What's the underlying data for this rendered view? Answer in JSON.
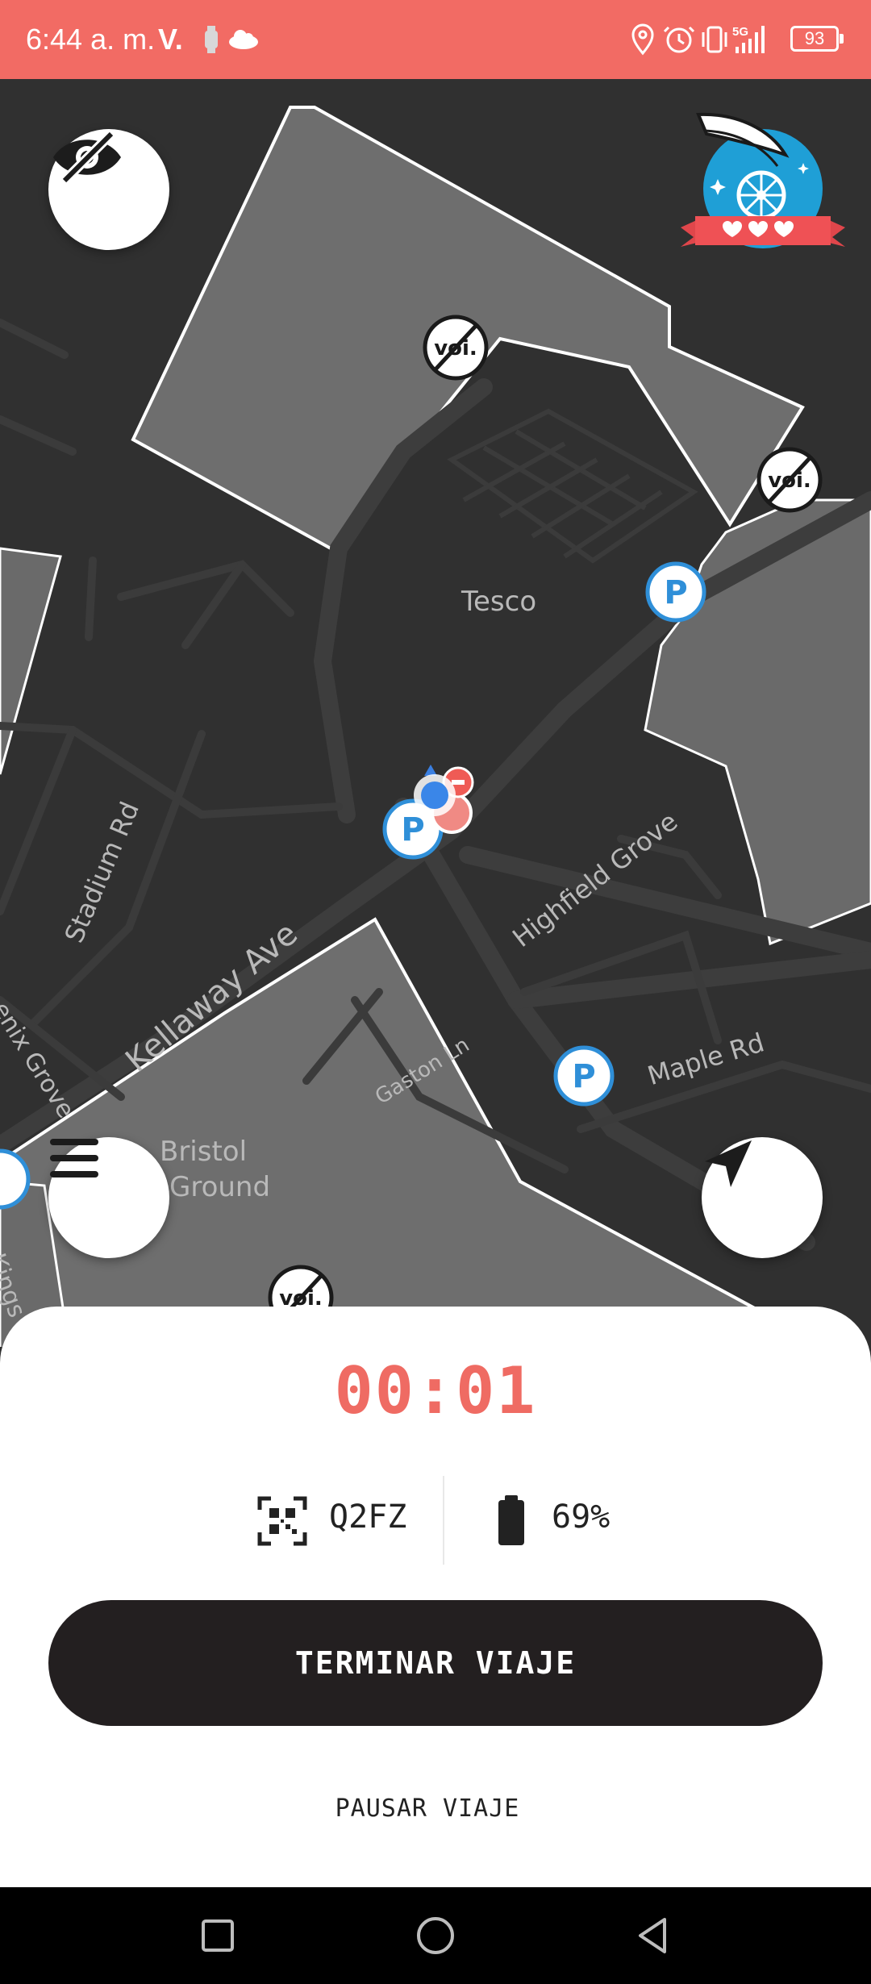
{
  "status_bar": {
    "time": "6:44 a. m.",
    "carrier": "V.",
    "network": "5G",
    "battery": "93",
    "background_color": "#f26b64"
  },
  "map": {
    "labels": {
      "tesco": "Tesco",
      "stadium_rd": "Stadium Rd",
      "kellaway_ave": "Kellaway Ave",
      "highfield_grove": "Highfield Grove",
      "maple_rd": "Maple Rd",
      "gaston_ln": "Gaston Ln",
      "bristol": "Bristol",
      "ground": "Ground",
      "phoenix_grove": "enix Grove",
      "kings": "Kings D"
    },
    "no_parking_marker": "voi.",
    "parking_marker": "P",
    "icons": [
      "eye-off-icon",
      "voi-wings-logo",
      "hamburger-menu-icon",
      "navigation-arrow-icon"
    ]
  },
  "ride": {
    "timer": "00:01",
    "vehicle_code": "Q2FZ",
    "battery_level": "69%",
    "end_trip_label": "TERMINAR VIAJE",
    "pause_trip_label": "PAUSAR VIAJE",
    "accent_color": "#ef6b63",
    "button_color": "#231f20"
  },
  "nav_bar": {
    "buttons": [
      "recents-square-icon",
      "home-circle-icon",
      "back-triangle-icon"
    ]
  }
}
